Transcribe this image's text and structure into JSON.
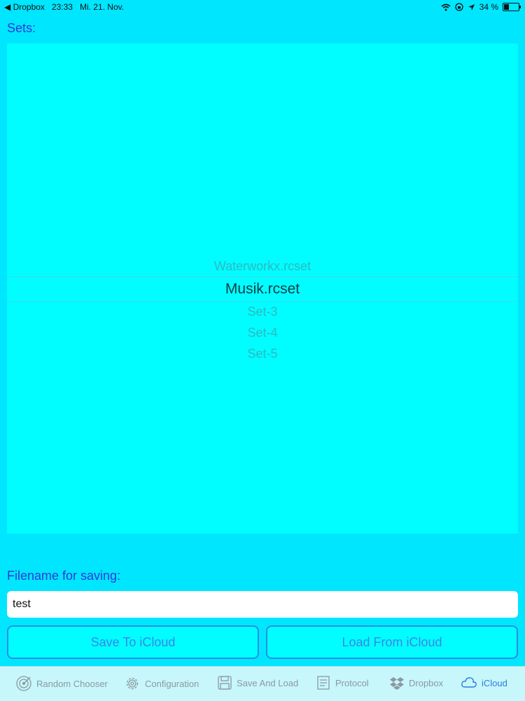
{
  "status": {
    "back_app": "Dropbox",
    "time": "23:33",
    "date": "Mi. 21. Nov.",
    "battery": "34 %"
  },
  "sets_label": "Sets:",
  "picker": {
    "items": [
      "Waterworkx.rcset",
      "Musik.rcset",
      "Set-3",
      "Set-4",
      "Set-5"
    ],
    "selected_index": 1
  },
  "filename_label": "Filename for saving:",
  "filename_value": "test",
  "buttons": {
    "save": "Save To iCloud",
    "load": "Load From iCloud"
  },
  "tabs": [
    {
      "label": "Random Chooser",
      "icon": "target-icon"
    },
    {
      "label": "Configuration",
      "icon": "gear-icon"
    },
    {
      "label": "Save And Load",
      "icon": "floppy-disk-icon"
    },
    {
      "label": "Protocol",
      "icon": "document-icon"
    },
    {
      "label": "Dropbox",
      "icon": "dropbox-icon"
    },
    {
      "label": "iCloud",
      "icon": "cloud-icon"
    }
  ],
  "active_tab": 5,
  "colors": {
    "background": "#00e6ff",
    "picker": "#00fdff",
    "label": "#2c3ad6",
    "accent": "#2a7de0"
  }
}
